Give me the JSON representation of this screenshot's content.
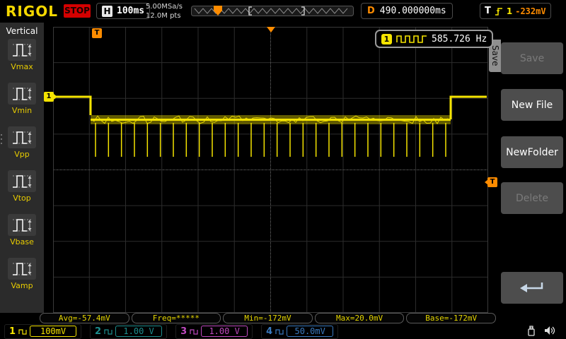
{
  "topbar": {
    "logo": "RIGOL",
    "run_state": "STOP",
    "horizontal": {
      "label": "H",
      "timebase": "100ms",
      "sample_rate": "5.00MSa/s",
      "mem_depth": "12.0M pts"
    },
    "delay": {
      "label": "D",
      "value": "490.000000ms"
    },
    "trigger": {
      "label": "T",
      "source": "1",
      "level": "-232mV"
    }
  },
  "sidebar": {
    "title": "Vertical",
    "items": [
      {
        "label": "Vmax"
      },
      {
        "label": "Vmin"
      },
      {
        "label": "Vpp"
      },
      {
        "label": "Vtop"
      },
      {
        "label": "Vbase"
      },
      {
        "label": "Vamp"
      }
    ]
  },
  "counter": {
    "channel": "1",
    "value": "585.726 Hz"
  },
  "markers": {
    "channel_tag": "1",
    "trigger_tag": "T",
    "trigger_color": "#ff8c00",
    "channel_color": "#f5e400"
  },
  "menu": {
    "tab": "Save",
    "buttons": [
      {
        "label": "Save",
        "enabled": false
      },
      {
        "label": "New File",
        "enabled": true
      },
      {
        "label": "NewFolder",
        "enabled": true
      },
      {
        "label": "Delete",
        "enabled": false
      }
    ]
  },
  "icons": {
    "back": "return-arrow",
    "usb": "usb-plug",
    "sound": "speaker",
    "coupling": "dc-coupling",
    "trigger_slope": "rising-edge"
  },
  "measurements": {
    "avg": "Avg=-57.4mV",
    "freq": "Freq=*****",
    "min": "Min=-172mV",
    "max": "Max=20.0mV",
    "base": "Base=-172mV"
  },
  "channels": [
    {
      "num": "1",
      "value": "100mV",
      "color": "#f5e400"
    },
    {
      "num": "2",
      "value": "1.00 V",
      "color": "#1d8f8f"
    },
    {
      "num": "3",
      "value": "1.00 V",
      "color": "#c04ac0"
    },
    {
      "num": "4",
      "value": "50.0mV",
      "color": "#3a7ac0"
    }
  ],
  "waveform": {
    "color": "#f5e400",
    "pulse_count": 28,
    "high_level": "20.0mV",
    "base_level": "-172mV"
  }
}
